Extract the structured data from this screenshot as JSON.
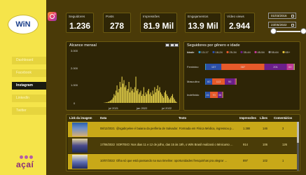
{
  "sidebar": {
    "logo_text": "WiN",
    "nav": [
      {
        "label": "Dashboard"
      },
      {
        "label": "Facebook"
      },
      {
        "label": "Instagram"
      },
      {
        "label": "LinkedIn"
      },
      {
        "label": "Twitter"
      }
    ],
    "brand": "açaí"
  },
  "header": {
    "platform_icon": "instagram-icon"
  },
  "kpis": [
    {
      "label": "Seguidores",
      "value": "1.236"
    },
    {
      "label": "Posts",
      "value": "278"
    },
    {
      "label": "Impressões",
      "value": "81.9 Mil"
    },
    {
      "label": "Engajamentos",
      "value": "13.9 Mil"
    },
    {
      "label": "Vídeo views",
      "value": "2.944"
    }
  ],
  "date_range": {
    "start": "01/03/2016",
    "end": "23/05/2022"
  },
  "alcance": {
    "title": "Alcance mensal",
    "y_ticks": [
      "3.000",
      "2.000",
      "1.000",
      "0"
    ],
    "x_ticks": [
      "jul 2021",
      "jan 2022",
      "jul 2022"
    ]
  },
  "genero": {
    "title": "Seguidores por gênero e idade",
    "legend_title": "Idade",
    "legend": [
      {
        "label": "13-17",
        "color": "#2e9ad0"
      },
      {
        "label": "18-24",
        "color": "#2b4fa8"
      },
      {
        "label": "25-34",
        "color": "#e65a2a"
      },
      {
        "label": "35-44",
        "color": "#6b1f8a"
      },
      {
        "label": "45-54",
        "color": "#c23a96"
      },
      {
        "label": "55-64",
        "color": "#8c8c8c"
      },
      {
        "label": "65+",
        "color": "#e0c03a"
      }
    ],
    "rows": [
      {
        "label": "Feminino",
        "segments": [
          {
            "v": 8,
            "label": ""
          },
          {
            "v": 137,
            "label": "137"
          },
          {
            "v": 387,
            "label": "387"
          },
          {
            "v": 201,
            "label": "201"
          },
          {
            "v": 60,
            "label": "60"
          },
          {
            "v": 8,
            "label": ""
          },
          {
            "v": 4,
            "label": ""
          }
        ]
      },
      {
        "label": "Masculino",
        "segments": [
          {
            "v": 3,
            "label": ""
          },
          {
            "v": 60,
            "label": "60"
          },
          {
            "v": 113,
            "label": "113"
          },
          {
            "v": 90,
            "label": "90"
          },
          {
            "v": 10,
            "label": ""
          },
          {
            "v": 3,
            "label": ""
          },
          {
            "v": 2,
            "label": ""
          }
        ]
      },
      {
        "label": "Indefinido",
        "segments": [
          {
            "v": 3,
            "label": ""
          },
          {
            "v": 41,
            "label": "41"
          },
          {
            "v": 70,
            "label": "70"
          },
          {
            "v": 36,
            "label": "36"
          },
          {
            "v": 6,
            "label": ""
          },
          {
            "v": 2,
            "label": ""
          },
          {
            "v": 1,
            "label": ""
          }
        ]
      }
    ]
  },
  "tabela": {
    "headers": [
      "Link da imagem",
      "Data",
      "Texto",
      "Impressões",
      "Likes",
      "Comentários"
    ],
    "rows": [
      {
        "data": "08/12/2021",
        "texto": "@sgabryelee é baiana da periferia de Salvador. Formada em Física Médica, ingressou p...",
        "impressoes": "1.388",
        "likes": "146",
        "comentarios": "3"
      },
      {
        "data": "17/06/2022",
        "texto": "SORTEIO: Nos dias 11 e 12 de julho, das 15 às 19h, o WiN Brasil realizará o Minicurso ...",
        "impressoes": "914",
        "likes": "106",
        "comentarios": "126"
      },
      {
        "data": "10/07/2022",
        "texto": "Olha só que está passando na sua timeline: oportunidades fresquinhas pra alegrar ...",
        "impressoes": "897",
        "likes": "102",
        "comentarios": "1"
      }
    ]
  },
  "chart_data": [
    {
      "type": "bar",
      "title": "Alcance mensal",
      "ylim": [
        0,
        3000
      ],
      "x_ticks": [
        "jul 2021",
        "jan 2022",
        "jul 2022"
      ],
      "values": [
        0,
        0,
        0,
        0,
        0,
        0,
        0,
        0,
        0,
        0,
        0,
        0,
        0,
        0,
        0,
        0,
        0,
        0,
        0,
        0,
        0,
        0,
        10,
        20,
        30,
        40,
        60,
        80,
        120,
        150,
        200,
        300,
        500,
        420,
        700,
        1000,
        600,
        800,
        1200,
        900,
        1500,
        1100,
        1300,
        900,
        1000,
        700,
        800,
        1200,
        600,
        900,
        700,
        800,
        600,
        900,
        1500,
        700,
        800,
        500,
        600,
        700,
        400,
        500,
        900,
        400,
        600,
        500,
        700,
        800,
        500,
        600,
        400,
        700,
        500,
        900,
        600,
        800,
        1000,
        700,
        900,
        600,
        500,
        400,
        300,
        600,
        700,
        500,
        400,
        300,
        200,
        300,
        400,
        500,
        300,
        200,
        100,
        50
      ]
    },
    {
      "type": "bar",
      "title": "Seguidores por gênero e idade",
      "categories": [
        "Feminino",
        "Masculino",
        "Indefinido"
      ],
      "series": [
        {
          "name": "13-17",
          "values": [
            8,
            3,
            3
          ]
        },
        {
          "name": "18-24",
          "values": [
            137,
            60,
            41
          ]
        },
        {
          "name": "25-34",
          "values": [
            387,
            113,
            70
          ]
        },
        {
          "name": "35-44",
          "values": [
            201,
            90,
            36
          ]
        },
        {
          "name": "45-54",
          "values": [
            60,
            10,
            6
          ]
        },
        {
          "name": "55-64",
          "values": [
            8,
            3,
            2
          ]
        },
        {
          "name": "65+",
          "values": [
            4,
            2,
            1
          ]
        }
      ]
    }
  ]
}
